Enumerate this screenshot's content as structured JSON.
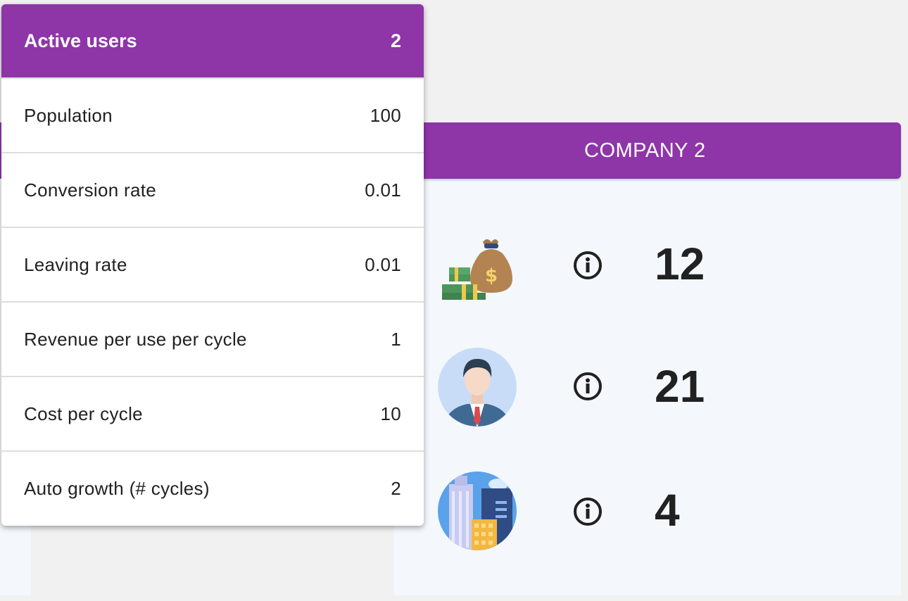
{
  "popup": {
    "header": {
      "label": "Active users",
      "value": "2"
    },
    "rows": [
      {
        "label": "Population",
        "value": "100"
      },
      {
        "label": "Conversion rate",
        "value": "0.01"
      },
      {
        "label": "Leaving rate",
        "value": "0.01"
      },
      {
        "label": "Revenue per use per cycle",
        "value": "1"
      },
      {
        "label": "Cost per cycle",
        "value": "10"
      },
      {
        "label": "Auto growth (# cycles)",
        "value": "2"
      }
    ]
  },
  "company": {
    "title": "COMPANY 2",
    "stats": [
      {
        "icon": "money-bag-icon",
        "value": "12"
      },
      {
        "icon": "businessman-icon",
        "value": "21"
      },
      {
        "icon": "city-buildings-icon",
        "value": "4"
      }
    ]
  },
  "colors": {
    "accent": "#8e35a8",
    "card_background": "#f4f8fc",
    "page_background": "#f1f1f1"
  }
}
